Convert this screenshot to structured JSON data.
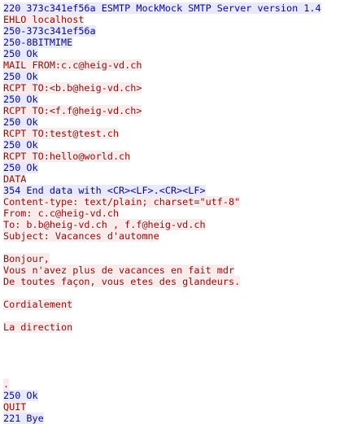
{
  "colors": {
    "server_text": "#0a0a8c",
    "server_bg": "#e8e8ff",
    "client_text": "#8a1010",
    "client_bg": "#f9ebeb"
  },
  "stream": [
    {
      "dir": "server",
      "text": "220 373c341ef56a ESMTP MockMock SMTP Server version 1.4"
    },
    {
      "dir": "client",
      "text": "EHLO localhost"
    },
    {
      "dir": "server",
      "text": "250-373c341ef56a"
    },
    {
      "dir": "server",
      "text": "250-8BITMIME"
    },
    {
      "dir": "server",
      "text": "250 Ok"
    },
    {
      "dir": "client",
      "text": "MAIL FROM:c.c@heig-vd.ch"
    },
    {
      "dir": "server",
      "text": "250 Ok"
    },
    {
      "dir": "client",
      "text": "RCPT TO:<b.b@heig-vd.ch>"
    },
    {
      "dir": "server",
      "text": "250 Ok"
    },
    {
      "dir": "client",
      "text": "RCPT TO:<f.f@heig-vd.ch>"
    },
    {
      "dir": "server",
      "text": "250 Ok"
    },
    {
      "dir": "client",
      "text": "RCPT TO:test@test.ch"
    },
    {
      "dir": "server",
      "text": "250 Ok"
    },
    {
      "dir": "client",
      "text": "RCPT TO:hello@world.ch"
    },
    {
      "dir": "server",
      "text": "250 Ok"
    },
    {
      "dir": "client",
      "text": "DATA"
    },
    {
      "dir": "server",
      "text": "354 End data with <CR><LF>.<CR><LF>"
    },
    {
      "dir": "client",
      "text": "Content-type: text/plain; charset=\"utf-8\""
    },
    {
      "dir": "client",
      "text": "From: c.c@heig-vd.ch"
    },
    {
      "dir": "client",
      "text": "To: b.b@heig-vd.ch , f.f@heig-vd.ch"
    },
    {
      "dir": "client",
      "text": "Subject: Vacances d'automne"
    },
    {
      "dir": "client",
      "text": ""
    },
    {
      "dir": "client",
      "text": "Bonjour,"
    },
    {
      "dir": "client",
      "text": "Vous n'avez plus de vacances en fait mdr"
    },
    {
      "dir": "client",
      "text": "De toutes façon, vous etes des glandeurs."
    },
    {
      "dir": "client",
      "text": ""
    },
    {
      "dir": "client",
      "text": "Cordialement"
    },
    {
      "dir": "client",
      "text": ""
    },
    {
      "dir": "client",
      "text": "La direction"
    },
    {
      "dir": "client",
      "text": ""
    },
    {
      "dir": "client",
      "text": ""
    },
    {
      "dir": "client",
      "text": ""
    },
    {
      "dir": "client",
      "text": ""
    },
    {
      "dir": "client",
      "text": "."
    },
    {
      "dir": "server",
      "text": "250 Ok"
    },
    {
      "dir": "client",
      "text": "QUIT"
    },
    {
      "dir": "server",
      "text": "221 Bye"
    }
  ]
}
